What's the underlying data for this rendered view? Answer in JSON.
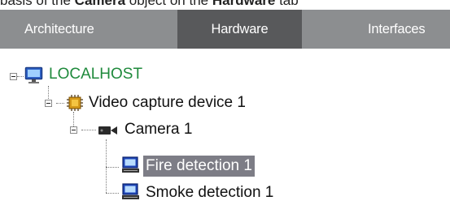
{
  "caption": {
    "part1": "basis of the ",
    "bold1": "Camera",
    "part2": " object on the ",
    "bold2": "Hardware",
    "part3": " tab"
  },
  "tabs": [
    {
      "label": "Architecture",
      "active": false
    },
    {
      "label": "Hardware",
      "active": true
    },
    {
      "label": "Interfaces",
      "active": false
    }
  ],
  "tree": {
    "root": {
      "label": "LOCALHOST",
      "icon": "computer-monitor-icon"
    },
    "capture": {
      "label": "Video capture device 1",
      "icon": "chip-icon"
    },
    "camera": {
      "label": "Camera 1",
      "icon": "video-camera-icon"
    },
    "fire": {
      "label": "Fire detection 1",
      "icon": "detector-computer-icon",
      "selected": true
    },
    "smoke": {
      "label": "Smoke detection 1",
      "icon": "detector-computer-icon"
    }
  },
  "colors": {
    "tabbar": "#8c8e90",
    "active_tab": "#58595b",
    "localhost": "#1f8a3c",
    "selection": "#7d7d86"
  }
}
